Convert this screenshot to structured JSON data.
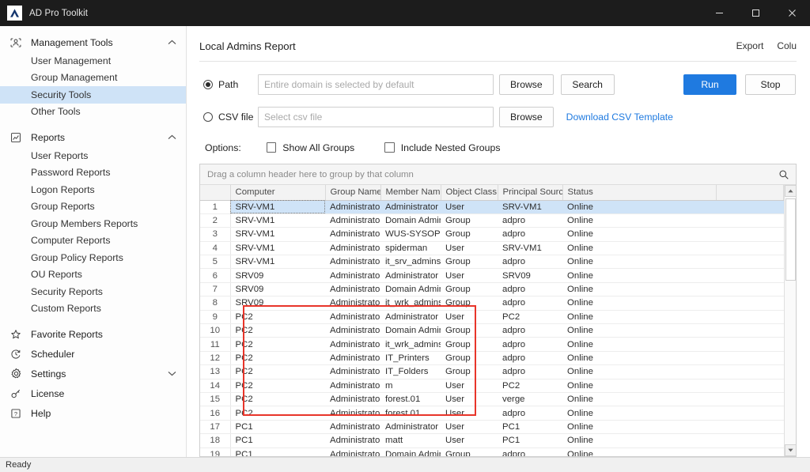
{
  "window": {
    "title": "AD Pro Toolkit",
    "icon": "app-logo-icon",
    "minimize": "minimize-icon",
    "maximize": "maximize-icon",
    "close": "close-icon"
  },
  "sidebar": {
    "groups": [
      {
        "label": "Management Tools",
        "icon": "users-management-icon",
        "expanded": true,
        "chevron": "chevron-up-icon",
        "children": [
          {
            "label": "User Management",
            "selected": false
          },
          {
            "label": "Group Management",
            "selected": false
          },
          {
            "label": "Security Tools",
            "selected": true
          },
          {
            "label": "Other Tools",
            "selected": false
          }
        ]
      },
      {
        "label": "Reports",
        "icon": "report-chart-icon",
        "expanded": true,
        "chevron": "chevron-up-icon",
        "children": [
          {
            "label": "User Reports",
            "selected": false
          },
          {
            "label": "Password Reports",
            "selected": false
          },
          {
            "label": "Logon Reports",
            "selected": false
          },
          {
            "label": "Group Reports",
            "selected": false
          },
          {
            "label": "Group Members Reports",
            "selected": false
          },
          {
            "label": "Computer Reports",
            "selected": false
          },
          {
            "label": "Group Policy Reports",
            "selected": false
          },
          {
            "label": "OU Reports",
            "selected": false
          },
          {
            "label": "Security Reports",
            "selected": false
          },
          {
            "label": "Custom Reports",
            "selected": false
          }
        ]
      }
    ],
    "items": [
      {
        "label": "Favorite Reports",
        "icon": "star-icon",
        "chevron": null
      },
      {
        "label": "Scheduler",
        "icon": "clock-refresh-icon",
        "chevron": null
      },
      {
        "label": "Settings",
        "icon": "gear-icon",
        "chevron": "chevron-down-icon"
      },
      {
        "label": "License",
        "icon": "key-icon",
        "chevron": null
      },
      {
        "label": "Help",
        "icon": "question-box-icon",
        "chevron": null
      }
    ]
  },
  "panel": {
    "title": "Local Admins Report",
    "actions": [
      {
        "label": "Export",
        "name": "export-button"
      },
      {
        "label": "Colu",
        "name": "columns-button"
      }
    ]
  },
  "form": {
    "path": {
      "radio_label": "Path",
      "selected": true,
      "placeholder": "Entire domain is selected by default",
      "value": "",
      "browse_label": "Browse",
      "search_label": "Search"
    },
    "csv": {
      "radio_label": "CSV file",
      "selected": false,
      "placeholder": "Select csv file",
      "value": "",
      "browse_label": "Browse",
      "template_link": "Download CSV Template"
    },
    "run_label": "Run",
    "stop_label": "Stop",
    "options_label": "Options:",
    "checkboxes": [
      {
        "label": "Show All Groups",
        "checked": false
      },
      {
        "label": "Include Nested Groups",
        "checked": false
      }
    ]
  },
  "grid": {
    "group_panel_hint": "Drag a column header here to group by that column",
    "search_icon": "search-icon",
    "columns": [
      "",
      "Computer",
      "Group Name",
      "Member Name",
      "Object Class",
      "Principal Source",
      "Status",
      ""
    ],
    "rows": [
      {
        "n": "1",
        "computer": "SRV-VM1",
        "group": "Administrators",
        "member": "Administrator",
        "objclass": "User",
        "source": "SRV-VM1",
        "status": "Online",
        "selected": true
      },
      {
        "n": "2",
        "computer": "SRV-VM1",
        "group": "Administrators",
        "member": "Domain Admins",
        "objclass": "Group",
        "source": "adpro",
        "status": "Online",
        "selected": false
      },
      {
        "n": "3",
        "computer": "SRV-VM1",
        "group": "Administrators",
        "member": "WUS-SYSOPS",
        "objclass": "Group",
        "source": "adpro",
        "status": "Online",
        "selected": false
      },
      {
        "n": "4",
        "computer": "SRV-VM1",
        "group": "Administrators",
        "member": "spiderman",
        "objclass": "User",
        "source": "SRV-VM1",
        "status": "Online",
        "selected": false
      },
      {
        "n": "5",
        "computer": "SRV-VM1",
        "group": "Administrators",
        "member": "it_srv_admins",
        "objclass": "Group",
        "source": "adpro",
        "status": "Online",
        "selected": false
      },
      {
        "n": "6",
        "computer": "SRV09",
        "group": "Administrators",
        "member": "Administrator",
        "objclass": "User",
        "source": "SRV09",
        "status": "Online",
        "selected": false
      },
      {
        "n": "7",
        "computer": "SRV09",
        "group": "Administrators",
        "member": "Domain Admins",
        "objclass": "Group",
        "source": "adpro",
        "status": "Online",
        "selected": false
      },
      {
        "n": "8",
        "computer": "SRV09",
        "group": "Administrators",
        "member": "it_wrk_admins",
        "objclass": "Group",
        "source": "adpro",
        "status": "Online",
        "selected": false
      },
      {
        "n": "9",
        "computer": "PC2",
        "group": "Administrators",
        "member": "Administrator",
        "objclass": "User",
        "source": "PC2",
        "status": "Online",
        "selected": false
      },
      {
        "n": "10",
        "computer": "PC2",
        "group": "Administrators",
        "member": "Domain Admins",
        "objclass": "Group",
        "source": "adpro",
        "status": "Online",
        "selected": false
      },
      {
        "n": "11",
        "computer": "PC2",
        "group": "Administrators",
        "member": "it_wrk_admins",
        "objclass": "Group",
        "source": "adpro",
        "status": "Online",
        "selected": false
      },
      {
        "n": "12",
        "computer": "PC2",
        "group": "Administrators",
        "member": "IT_Printers",
        "objclass": "Group",
        "source": "adpro",
        "status": "Online",
        "selected": false
      },
      {
        "n": "13",
        "computer": "PC2",
        "group": "Administrators",
        "member": "IT_Folders",
        "objclass": "Group",
        "source": "adpro",
        "status": "Online",
        "selected": false
      },
      {
        "n": "14",
        "computer": "PC2",
        "group": "Administrators",
        "member": "m",
        "objclass": "User",
        "source": "PC2",
        "status": "Online",
        "selected": false
      },
      {
        "n": "15",
        "computer": "PC2",
        "group": "Administrators",
        "member": "forest.01",
        "objclass": "User",
        "source": "verge",
        "status": "Online",
        "selected": false
      },
      {
        "n": "16",
        "computer": "PC2",
        "group": "Administrators",
        "member": "forest.01",
        "objclass": "User",
        "source": "adpro",
        "status": "Online",
        "selected": false
      },
      {
        "n": "17",
        "computer": "PC1",
        "group": "Administrators",
        "member": "Administrator",
        "objclass": "User",
        "source": "PC1",
        "status": "Online",
        "selected": false
      },
      {
        "n": "18",
        "computer": "PC1",
        "group": "Administrators",
        "member": "matt",
        "objclass": "User",
        "source": "PC1",
        "status": "Online",
        "selected": false
      },
      {
        "n": "19",
        "computer": "PC1",
        "group": "Administrators",
        "member": "Domain Admins",
        "objclass": "Group",
        "source": "adpro",
        "status": "Online",
        "selected": false
      }
    ],
    "scrollbar": {
      "up": "scroll-up-icon",
      "down": "scroll-down-icon"
    }
  },
  "annotation": {
    "color": "#e8352a",
    "highlights_rows": [
      "9",
      "10",
      "11",
      "12",
      "13",
      "14",
      "15",
      "16"
    ]
  },
  "statusbar": {
    "text": "Ready"
  },
  "colors": {
    "accent": "#1f7ae0",
    "selection": "#cfe3f7",
    "titlebar": "#1c1c1c",
    "annotation": "#e8352a"
  }
}
